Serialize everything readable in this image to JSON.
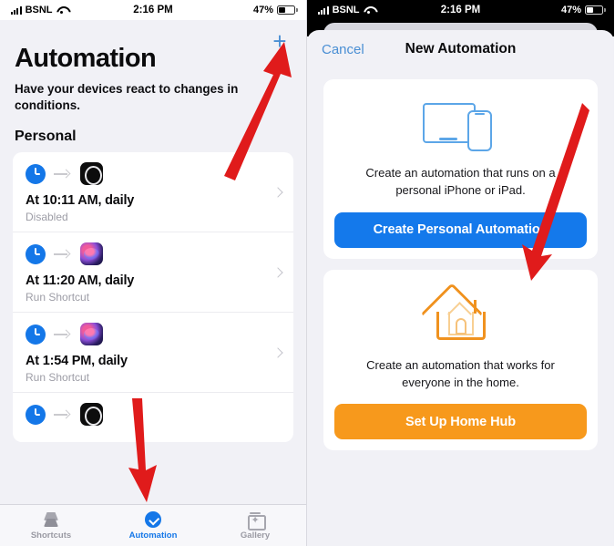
{
  "status_bar": {
    "carrier": "BSNL",
    "time": "2:16 PM",
    "battery": "47%"
  },
  "left_panel": {
    "add_button": "+",
    "title": "Automation",
    "subtitle": "Have your devices react to changes in conditions.",
    "section_header": "Personal",
    "automations": [
      {
        "title": "At 10:11 AM, daily",
        "subtitle": "Disabled",
        "app_icon": "watch-app-icon"
      },
      {
        "title": "At 11:20 AM, daily",
        "subtitle": "Run Shortcut",
        "app_icon": "siri-shortcuts-app-icon"
      },
      {
        "title": "At 1:54 PM, daily",
        "subtitle": "Run Shortcut",
        "app_icon": "siri-shortcuts-app-icon"
      },
      {
        "title": "",
        "subtitle": "",
        "app_icon": "watch-app-icon"
      }
    ],
    "tabs": [
      {
        "label": "Shortcuts",
        "icon": "shortcuts-icon",
        "active": false
      },
      {
        "label": "Automation",
        "icon": "automation-icon",
        "active": true
      },
      {
        "label": "Gallery",
        "icon": "gallery-icon",
        "active": false
      }
    ]
  },
  "right_panel": {
    "cancel_label": "Cancel",
    "sheet_title": "New Automation",
    "options": [
      {
        "icon": "devices-tablet-phone-icon",
        "description": "Create an automation that runs on a personal iPhone or iPad.",
        "button_label": "Create Personal Automation",
        "button_color": "#1479eb"
      },
      {
        "icon": "home-hub-icon",
        "description": "Create an automation that works for everyone in the home.",
        "button_label": "Set Up Home Hub",
        "button_color": "#f7991c"
      }
    ]
  },
  "annotations": {
    "arrow_color": "#e01b1b",
    "arrows": [
      {
        "name": "arrow-to-add-button",
        "target": "add-button"
      },
      {
        "name": "arrow-to-automation-tab",
        "target": "tab-automation"
      },
      {
        "name": "arrow-to-create-personal-automation",
        "target": "create-personal-automation-button"
      }
    ]
  }
}
